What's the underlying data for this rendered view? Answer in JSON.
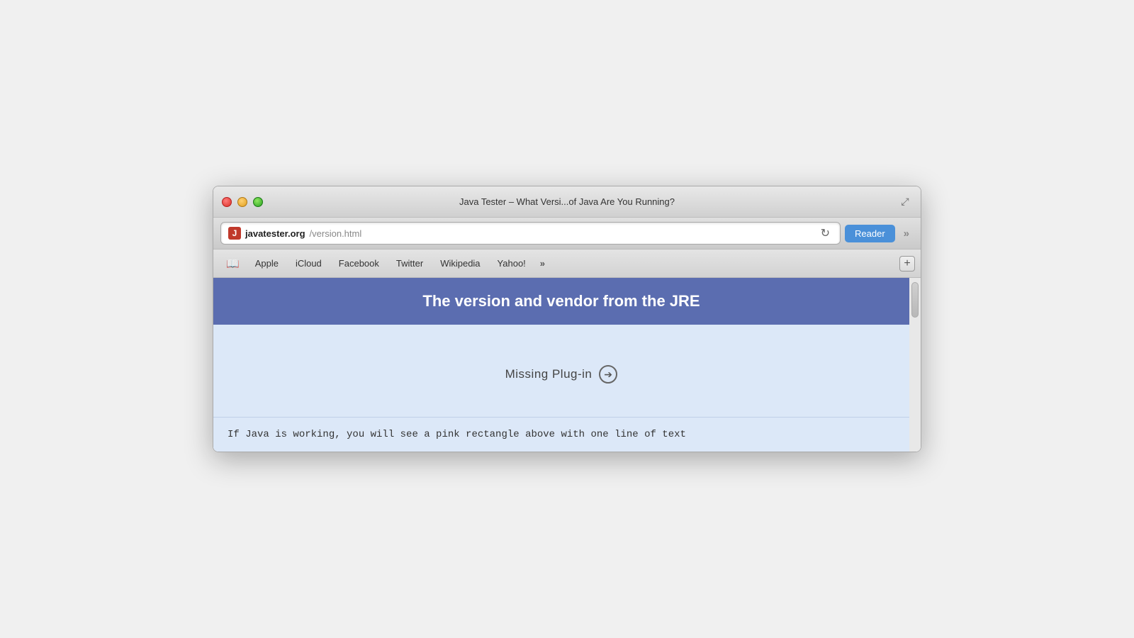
{
  "window": {
    "title": "Java Tester – What Versi...of Java Are You Running?",
    "traffic_lights": {
      "close": "close",
      "minimize": "minimize",
      "maximize": "maximize"
    }
  },
  "address_bar": {
    "favicon_letter": "J",
    "url_domain": "javatester.org",
    "url_path": "/version.html",
    "reader_label": "Reader",
    "reload_symbol": "↻"
  },
  "bookmarks": {
    "items": [
      {
        "label": "Apple"
      },
      {
        "label": "iCloud"
      },
      {
        "label": "Facebook"
      },
      {
        "label": "Twitter"
      },
      {
        "label": "Wikipedia"
      },
      {
        "label": "Yahoo!"
      }
    ],
    "overflow_symbol": "»",
    "new_tab_symbol": "+"
  },
  "page": {
    "header": "The version and vendor from the JRE",
    "missing_plugin_label": "Missing Plug-in",
    "missing_plugin_icon": "➔",
    "footer_text": "If Java is working, you will see a pink rectangle above with one line of text"
  }
}
